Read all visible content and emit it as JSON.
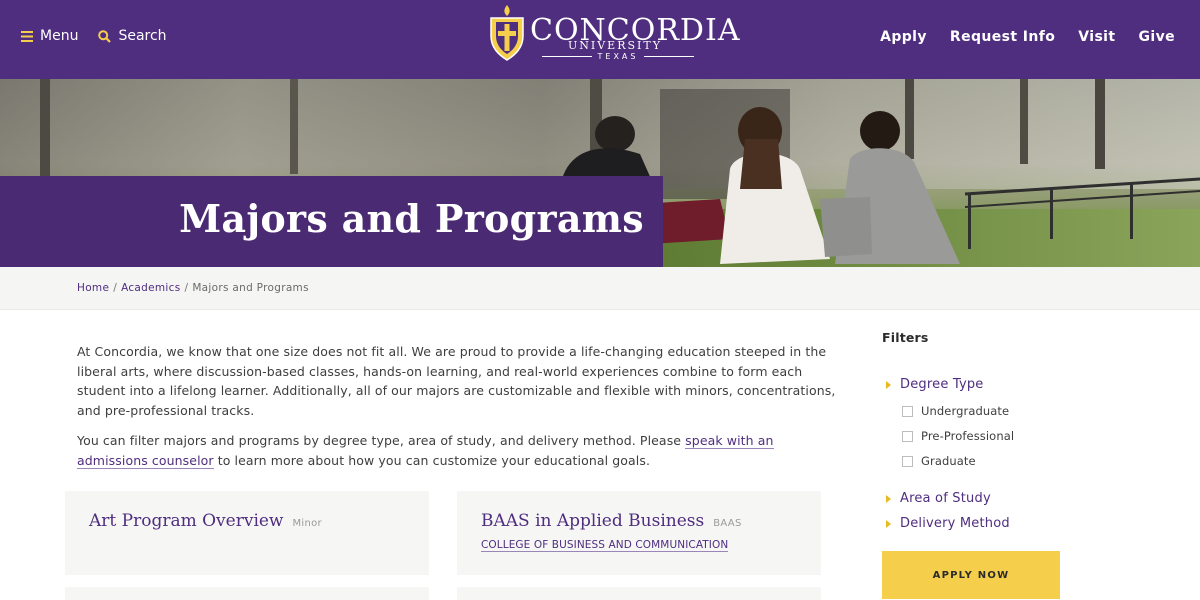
{
  "header": {
    "menu_label": "Menu",
    "search_label": "Search",
    "logo": {
      "word": "CONCORDIA",
      "sub": "UNIVERSITY",
      "state": "TEXAS"
    },
    "nav": [
      "Apply",
      "Request Info",
      "Visit",
      "Give"
    ],
    "colors": {
      "background": "#4f2d7f",
      "accent": "#f5cf4c"
    }
  },
  "hero": {
    "title": "Majors and Programs"
  },
  "breadcrumb": {
    "home": "Home",
    "academics": "Academics",
    "current": "Majors and Programs",
    "separator": "/"
  },
  "intro": {
    "p1": "At Concordia, we know that one size does not fit all. We are proud to provide a life-changing education steeped in the liberal arts, where discussion-based classes, hands-on learning, and real-world experiences combine to form each student into a lifelong learner. Additionally, all of our majors are customizable and flexible with minors, concentrations, and pre-professional tracks.",
    "p2_before": "You can filter majors and programs by degree type, area of study, and delivery method. Please ",
    "p2_link": "speak with an admissions counselor",
    "p2_after": " to learn more about how you can customize your educational goals."
  },
  "programs": [
    {
      "name": "Art Program Overview",
      "tag": "Minor",
      "college": ""
    },
    {
      "name": "BAAS in Applied Business",
      "tag": "BAAS",
      "college": "COLLEGE OF BUSINESS AND COMMUNICATION"
    }
  ],
  "filters": {
    "title": "Filters",
    "degree_type": "Degree Type",
    "options": [
      "Undergraduate",
      "Pre-Professional",
      "Graduate"
    ],
    "area_of_study": "Area of Study",
    "delivery_method": "Delivery Method",
    "apply_label": "APPLY NOW"
  }
}
